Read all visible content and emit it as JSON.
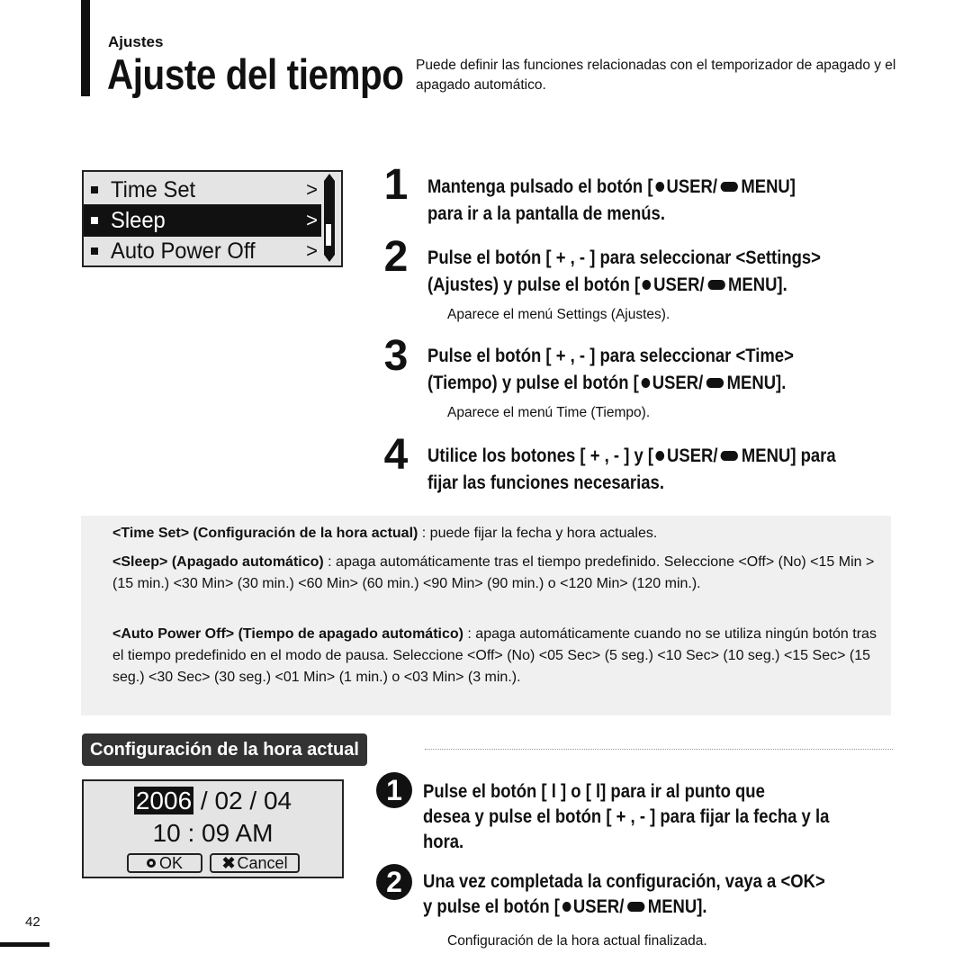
{
  "header": {
    "section": "Ajustes",
    "title": "Ajuste del tiempo",
    "intro": "Puede definir las funciones relacionadas con el temporizador de apagado y el apagado automático."
  },
  "menu_screen": {
    "items": [
      {
        "label": "Time Set",
        "selected": false
      },
      {
        "label": "Sleep",
        "selected": true
      },
      {
        "label": "Auto Power Off",
        "selected": false
      }
    ],
    "chevron": ">",
    "scroll_position": 0.85
  },
  "buttons": {
    "user": "USER/",
    "menu": "MENU"
  },
  "steps": [
    {
      "num": "1",
      "pre": "Mantenga pulsado el botón [",
      "post": "]",
      "line2": "para ir a la pantalla de menús."
    },
    {
      "num": "2",
      "line1": "Pulse el botón [ + , - ] para seleccionar <Settings>",
      "pre": "(Ajustes) y pulse el botón [",
      "post": "].",
      "note": "Aparece el menú Settings (Ajustes)."
    },
    {
      "num": "3",
      "line1": "Pulse el botón [ + , - ] para seleccionar <Time>",
      "pre": "(Tiempo) y pulse el botón [",
      "post": "].",
      "note": "Aparece el menú Time (Tiempo)."
    },
    {
      "num": "4",
      "pre": "Utilice los botones [ + , - ] y [",
      "post": "] para",
      "line2": "fijar las funciones necesarias."
    }
  ],
  "info": {
    "time_set": {
      "term": "<Time Set> (Configuración de la hora actual)",
      "desc": " : puede fijar la fecha y hora actuales."
    },
    "sleep": {
      "term": "<Sleep> (Apagado automático)",
      "desc": " : apaga automáticamente tras el tiempo predefinido. Seleccione <Off> (No) <15 Min > (15 min.) <30 Min> (30 min.) <60 Min> (60 min.) <90 Min> (90 min.) o <120 Min> (120 min.)."
    },
    "auto_power_off": {
      "term": "<Auto Power Off> (Tiempo de apagado automático)",
      "desc": " : apaga automáticamente cuando no se utiliza ningún botón tras el tiempo predefinido en el modo de pausa. Seleccione <Off> (No) <05 Sec> (5 seg.) <10 Sec> (10 seg.) <15 Sec> (15 seg.) <30 Sec> (30 seg.) <01 Min> (1 min.) o <03 Min> (3 min.)."
    }
  },
  "subsection": {
    "title": "Configuración de la hora actual"
  },
  "date_screen": {
    "year": "2006",
    "rest_date": " / 02 / 04",
    "time": "10 : 09  AM",
    "ok": "OK",
    "cancel": "Cancel"
  },
  "sub_steps": [
    {
      "num": "1",
      "line1": "Pulse el botón [ l       ] o [       l] para ir al punto que",
      "line2": "desea  y pulse el botón [ + , - ] para fijar la fecha y la",
      "line3": "hora."
    },
    {
      "num": "2",
      "line1": "Una vez completada la configuración, vaya a <OK>",
      "pre": "y pulse el botón [",
      "post": "].",
      "note": "Configuración de la hora actual finalizada."
    }
  ],
  "page_number": "42"
}
